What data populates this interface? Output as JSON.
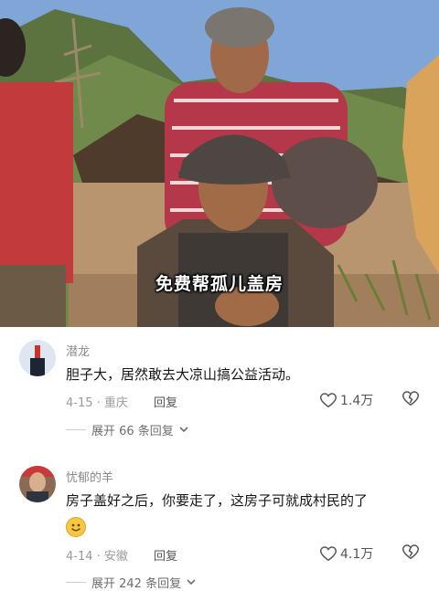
{
  "video": {
    "subtitle": "免费帮孤儿盖房"
  },
  "comments": [
    {
      "username": "潜龙",
      "text": "胆子大，居然敢去大凉山搞公益活动。",
      "date_location": "4-15 · 重庆",
      "reply_label": "回复",
      "likes": "1.4万",
      "expand_label": "展开 66 条回复"
    },
    {
      "username": "忧郁的羊",
      "text": "房子盖好之后，你要走了，这房子可就成村民的了",
      "emoji": "smiling-face-emoji",
      "date_location": "4-14 · 安徽",
      "reply_label": "回复",
      "likes": "4.1万",
      "expand_label": "展开 242 条回复"
    }
  ],
  "colors": {
    "text": "#161616",
    "meta": "#9a9a9a",
    "background": "#ffffff"
  }
}
